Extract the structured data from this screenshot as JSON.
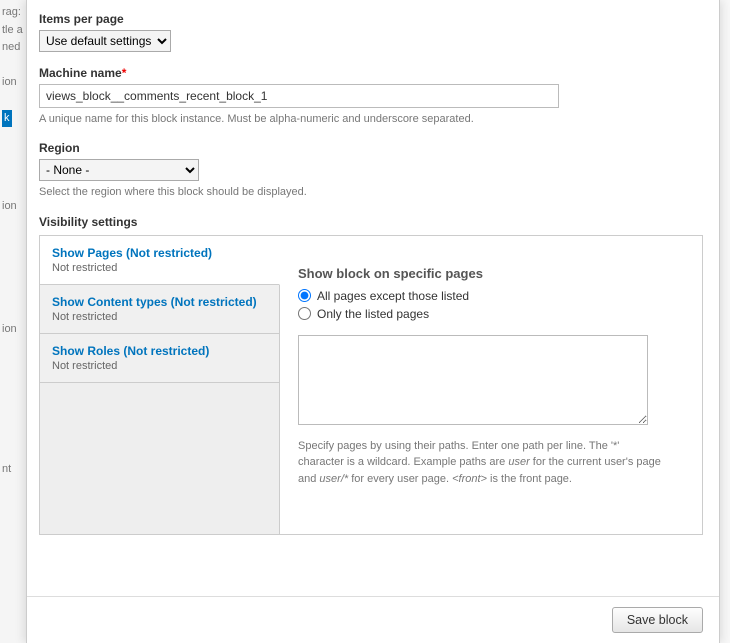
{
  "bg_left": [
    "rag:",
    "tle a",
    "ned",
    "",
    "ion",
    "",
    "k",
    "",
    "",
    "",
    "",
    "ion",
    "",
    "",
    "",
    "",
    "",
    "",
    "ion",
    "",
    "",
    "",
    "",
    "",
    "",
    "",
    "nt"
  ],
  "items_per_page": {
    "label": "Items per page",
    "value": "Use default settings"
  },
  "machine_name": {
    "label": "Machine name",
    "value": "views_block__comments_recent_block_1",
    "description": "A unique name for this block instance. Must be alpha-numeric and underscore separated."
  },
  "region": {
    "label": "Region",
    "value": "- None -",
    "description": "Select the region where this block should be displayed."
  },
  "visibility": {
    "title": "Visibility settings",
    "tabs": [
      {
        "title": "Show Pages (Not restricted)",
        "sub": "Not restricted"
      },
      {
        "title": "Show Content types (Not restricted)",
        "sub": "Not restricted"
      },
      {
        "title": "Show Roles (Not restricted)",
        "sub": "Not restricted"
      }
    ],
    "pane": {
      "title": "Show block on specific pages",
      "radio1": "All pages except those listed",
      "radio2": "Only the listed pages",
      "textarea_value": "",
      "help_prefix": "Specify pages by using their paths. Enter one path per line. The '*' character is a wildcard. Example paths are ",
      "help_em1": "user",
      "help_mid1": " for the current user's page and ",
      "help_em2": "user/*",
      "help_mid2": " for every user page. ",
      "help_em3": "<front>",
      "help_suffix": " is the front page."
    }
  },
  "footer": {
    "save": "Save block"
  }
}
